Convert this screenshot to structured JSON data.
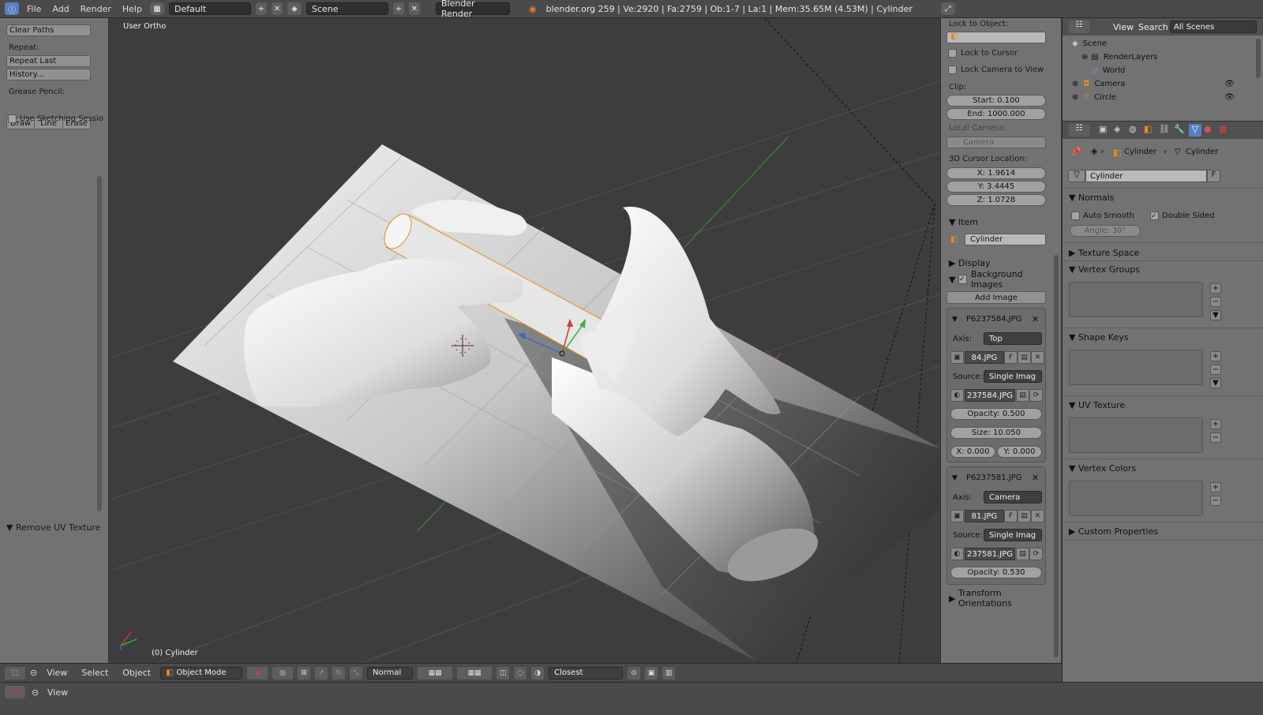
{
  "topbar": {
    "menus": [
      "File",
      "Add",
      "Render",
      "Help"
    ],
    "screen_layout": "Default",
    "scene": "Scene",
    "render_engine": "Blender Render",
    "stats": "blender.org 259 | Ve:2920 | Fa:2759 | Ob:1-7 | La:1 | Mem:35.65M (4.53M) | Cylinder"
  },
  "tool_panel": {
    "clear_paths": "Clear Paths",
    "repeat_label": "Repeat:",
    "repeat_last": "Repeat Last",
    "history": "History...",
    "grease_pencil_label": "Grease Pencil:",
    "draw": "Draw",
    "line": "Line",
    "erase": "Erase",
    "use_sketching": "Use Sketching Sessio",
    "remove_uv_texture": "Remove UV Texture"
  },
  "viewport": {
    "view_name": "User Ortho",
    "object_label": "(0) Cylinder"
  },
  "n_panel": {
    "lock_to_object": "Lock to Object:",
    "lock_to_cursor": "Lock to Cursor",
    "lock_camera_to_view": "Lock Camera to View",
    "clip_label": "Clip:",
    "clip_start": "Start: 0.100",
    "clip_end": "End: 1000.000",
    "local_camera_label": "Local Camera:",
    "local_camera": "Camera",
    "cursor_label": "3D Cursor Location:",
    "cursor_x": "X: 1.9614",
    "cursor_y": "Y: 3.4445",
    "cursor_z": "Z: 1.0728",
    "item_header": "Item",
    "item_name": "Cylinder",
    "display_header": "Display",
    "bg_images_header": "Background Images",
    "add_image": "Add Image",
    "bg1": {
      "name": "P6237584.JPG",
      "axis_label": "Axis:",
      "axis": "Top",
      "image": "84.JPG",
      "fake": "F",
      "source_label": "Source:",
      "source": "Single Imag",
      "file": "237584.JPG",
      "opacity": "Opacity: 0.500",
      "size": "Size: 10.050",
      "x": "X: 0.000",
      "y": "Y: 0.000"
    },
    "bg2": {
      "name": "P6237581.JPG",
      "axis_label": "Axis:",
      "axis": "Camera",
      "image": "81.JPG",
      "fake": "F",
      "source_label": "Source:",
      "source": "Single Imag",
      "file": "237581.JPG",
      "opacity": "Opacity: 0.530"
    },
    "transform_orientations": "Transform Orientations"
  },
  "outliner": {
    "view": "View",
    "search": "Search",
    "filter": "All Scenes",
    "items": [
      "Scene",
      "RenderLayers",
      "World",
      "Camera",
      "Circle"
    ]
  },
  "properties": {
    "breadcrumb_object": "Cylinder",
    "breadcrumb_data": "Cylinder",
    "mesh_name": "Cylinder",
    "fake_user": "F",
    "normals": "Normals",
    "auto_smooth": "Auto Smooth",
    "double_sided": "Double Sided",
    "angle": "Angle: 30°",
    "texture_space": "Texture Space",
    "vertex_groups": "Vertex Groups",
    "shape_keys": "Shape Keys",
    "uv_texture": "UV Texture",
    "vertex_colors": "Vertex Colors",
    "custom_properties": "Custom Properties"
  },
  "bottombar": {
    "menus": [
      "View",
      "Select",
      "Object"
    ],
    "mode": "Object Mode",
    "orientation": "Normal",
    "snap": "Closest"
  },
  "timeline": {
    "view": "View"
  },
  "colors": {
    "accent_blue": "#5680c2",
    "x_axis": "#c83c3c",
    "y_axis": "#3cb43c",
    "z_axis": "#3c64d2",
    "selection": "#e09020"
  }
}
